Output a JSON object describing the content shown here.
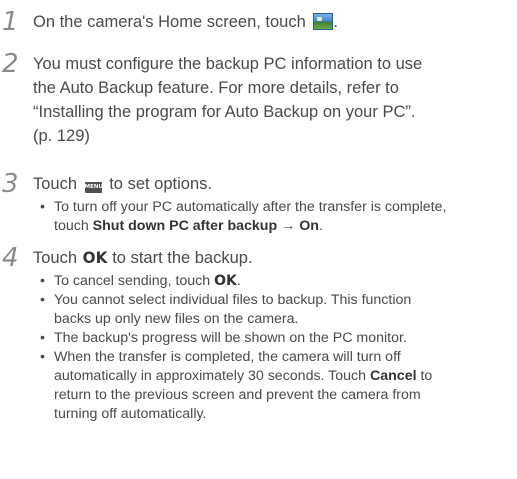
{
  "steps": [
    {
      "number": "1",
      "text_before": "On the camera's Home screen, touch",
      "icon": "home-photo-icon",
      "text_after": "."
    },
    {
      "number": "2",
      "line1": "You must configure the backup PC information to use",
      "line2": "the Auto Backup feature. For more details, refer to",
      "line3": "“Installing the program for Auto Backup on your PC”.",
      "line4": "(p. 129)"
    },
    {
      "number": "3",
      "text_before": "Touch",
      "icon_label": "MENU",
      "text_after": "to set options.",
      "bullets": [
        {
          "line1": "To turn off your PC automatically after the transfer is complete,",
          "line2_before": "touch",
          "bold1": "Shut down PC after backup",
          "arrow": "→",
          "bold2": "On",
          "line2_after": "."
        }
      ]
    },
    {
      "number": "4",
      "text_before": "Touch",
      "ok_label": "OK",
      "text_after": "to start the backup.",
      "bullets": [
        {
          "before": "To cancel sending, touch",
          "ok_label": "OK",
          "after": "."
        },
        {
          "line1": "You cannot select individual files to backup. This function",
          "line2": "backs up only new files on the camera."
        },
        {
          "line1": "The backup's progress will be shown on the PC monitor."
        },
        {
          "line1": "When the transfer is completed, the camera will turn off",
          "line2_before": "automatically in approximately 30 seconds. Touch",
          "bold": "Cancel",
          "line2_after": "to",
          "line3": "return to the previous screen and prevent the camera from",
          "line4": "turning off automatically."
        }
      ]
    }
  ]
}
